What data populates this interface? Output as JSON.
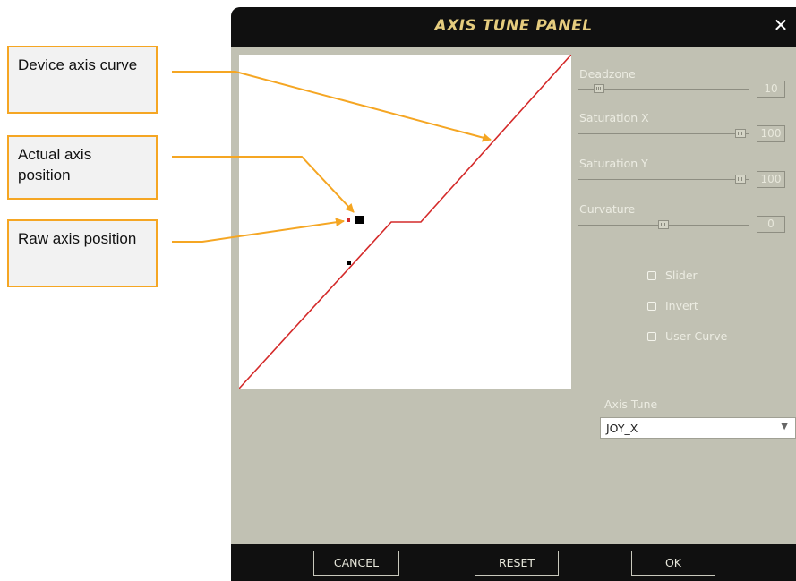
{
  "callouts": {
    "device_axis_curve": "Device axis curve",
    "actual_axis_position": "Actual axis position",
    "raw_axis_position": "Raw axis position"
  },
  "window": {
    "title": "AXIS TUNE PANEL",
    "close_glyph": "✕"
  },
  "controls": {
    "deadzone": {
      "label": "Deadzone",
      "value": "10",
      "slider_fraction": 0.12
    },
    "saturation_x": {
      "label": "Saturation X",
      "value": "100",
      "slider_fraction": 1.0
    },
    "saturation_y": {
      "label": "Saturation Y",
      "value": "100",
      "slider_fraction": 1.0
    },
    "curvature": {
      "label": "Curvature",
      "value": "0",
      "slider_fraction": 0.5
    }
  },
  "checkboxes": [
    {
      "label": "Slider",
      "checked": false
    },
    {
      "label": "Invert",
      "checked": false
    },
    {
      "label": "User Curve",
      "checked": false
    }
  ],
  "axis_tune": {
    "label": "Axis Tune",
    "selected": "JOY_X",
    "arrow_icon": "chevron-down-icon"
  },
  "footer": {
    "cancel": "CANCEL",
    "reset": "RESET",
    "ok": "OK"
  },
  "colors": {
    "accent_title": "#e5cc7e",
    "curve": "#d42a2a",
    "callout_border": "#f5a623",
    "panel_bg": "#c1c1b3"
  }
}
